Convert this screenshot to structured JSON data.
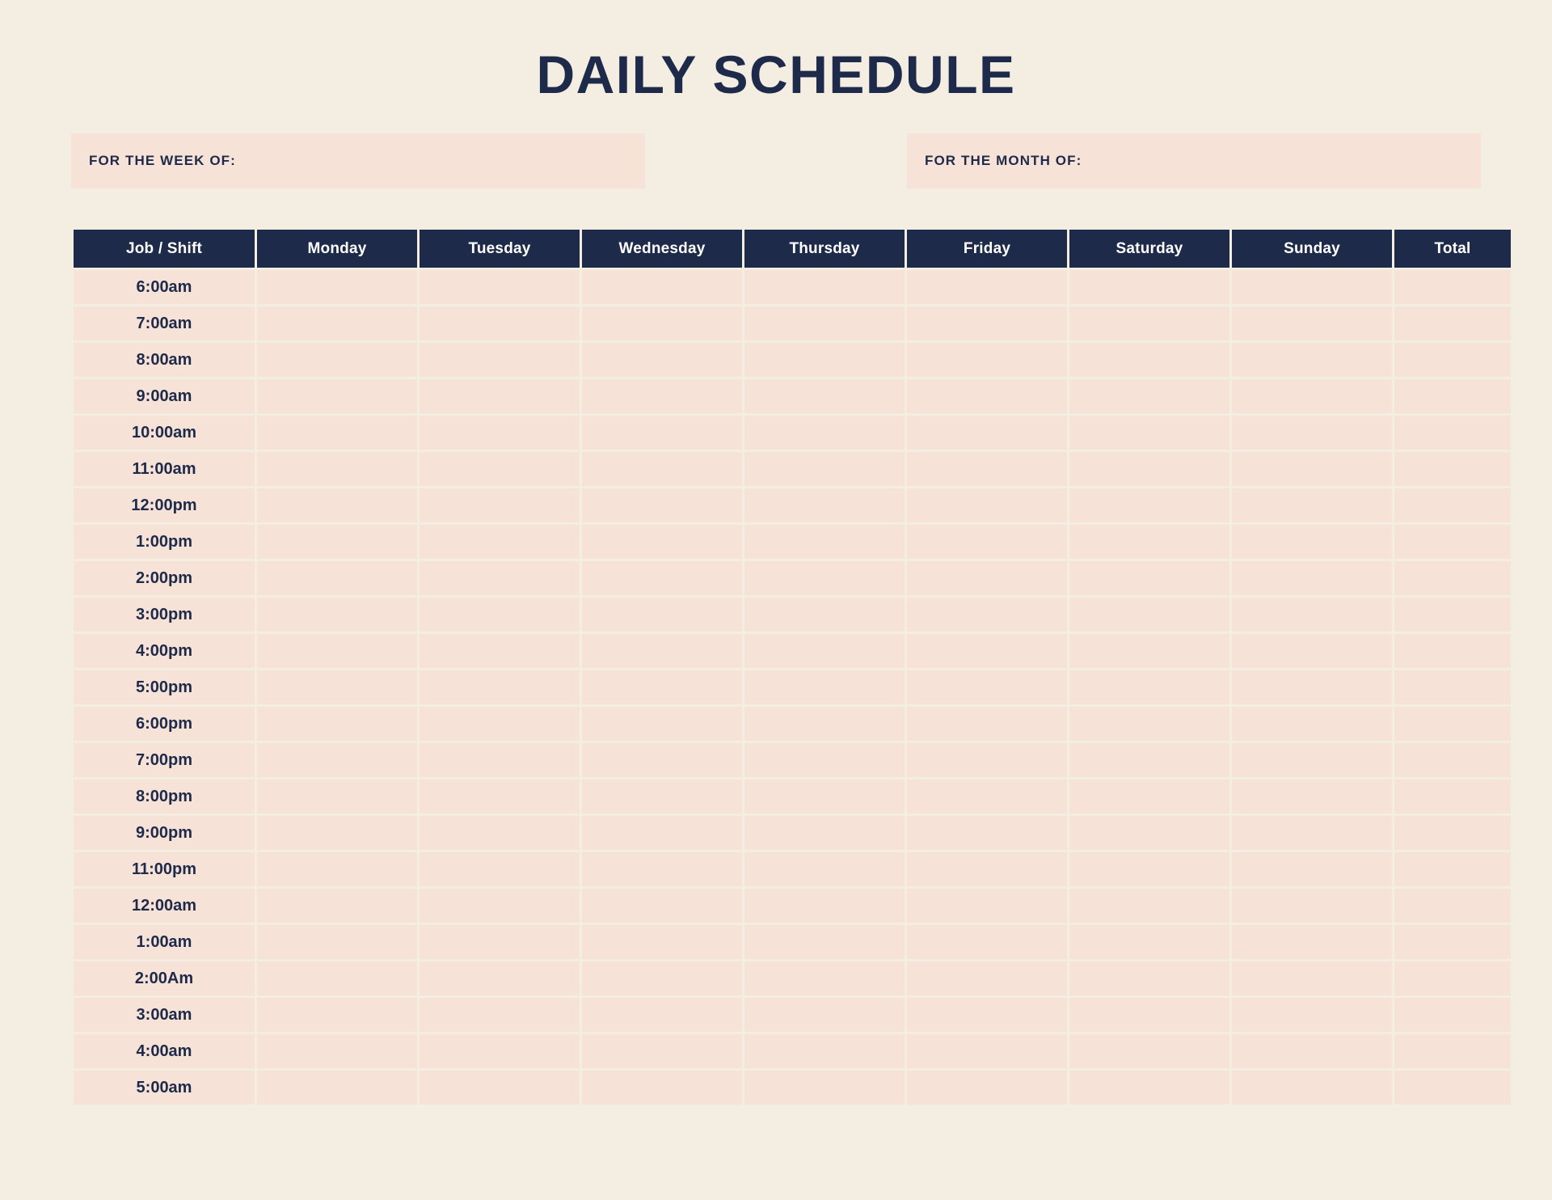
{
  "page": {
    "title": "DAILY SCHEDULE",
    "background_color": "#F4EDE1",
    "accent_navy": "#1E2A4A",
    "cell_peach": "#F7E2D7"
  },
  "meta": {
    "week_label": "FOR THE WEEK OF:",
    "week_value": "",
    "month_label": "FOR THE MONTH OF:",
    "month_value": ""
  },
  "table": {
    "columns": [
      "Job / Shift",
      "Monday",
      "Tuesday",
      "Wednesday",
      "Thursday",
      "Friday",
      "Saturday",
      "Sunday",
      "Total"
    ],
    "rows": [
      {
        "time": "6:00am",
        "entries": [
          "",
          "",
          "",
          "",
          "",
          "",
          "",
          ""
        ]
      },
      {
        "time": "7:00am",
        "entries": [
          "",
          "",
          "",
          "",
          "",
          "",
          "",
          ""
        ]
      },
      {
        "time": "8:00am",
        "entries": [
          "",
          "",
          "",
          "",
          "",
          "",
          "",
          ""
        ]
      },
      {
        "time": "9:00am",
        "entries": [
          "",
          "",
          "",
          "",
          "",
          "",
          "",
          ""
        ]
      },
      {
        "time": "10:00am",
        "entries": [
          "",
          "",
          "",
          "",
          "",
          "",
          "",
          ""
        ]
      },
      {
        "time": "11:00am",
        "entries": [
          "",
          "",
          "",
          "",
          "",
          "",
          "",
          ""
        ]
      },
      {
        "time": "12:00pm",
        "entries": [
          "",
          "",
          "",
          "",
          "",
          "",
          "",
          ""
        ]
      },
      {
        "time": "1:00pm",
        "entries": [
          "",
          "",
          "",
          "",
          "",
          "",
          "",
          ""
        ]
      },
      {
        "time": "2:00pm",
        "entries": [
          "",
          "",
          "",
          "",
          "",
          "",
          "",
          ""
        ]
      },
      {
        "time": "3:00pm",
        "entries": [
          "",
          "",
          "",
          "",
          "",
          "",
          "",
          ""
        ]
      },
      {
        "time": "4:00pm",
        "entries": [
          "",
          "",
          "",
          "",
          "",
          "",
          "",
          ""
        ]
      },
      {
        "time": "5:00pm",
        "entries": [
          "",
          "",
          "",
          "",
          "",
          "",
          "",
          ""
        ]
      },
      {
        "time": "6:00pm",
        "entries": [
          "",
          "",
          "",
          "",
          "",
          "",
          "",
          ""
        ]
      },
      {
        "time": "7:00pm",
        "entries": [
          "",
          "",
          "",
          "",
          "",
          "",
          "",
          ""
        ]
      },
      {
        "time": "8:00pm",
        "entries": [
          "",
          "",
          "",
          "",
          "",
          "",
          "",
          ""
        ]
      },
      {
        "time": "9:00pm",
        "entries": [
          "",
          "",
          "",
          "",
          "",
          "",
          "",
          ""
        ]
      },
      {
        "time": "11:00pm",
        "entries": [
          "",
          "",
          "",
          "",
          "",
          "",
          "",
          ""
        ]
      },
      {
        "time": "12:00am",
        "entries": [
          "",
          "",
          "",
          "",
          "",
          "",
          "",
          ""
        ]
      },
      {
        "time": "1:00am",
        "entries": [
          "",
          "",
          "",
          "",
          "",
          "",
          "",
          ""
        ]
      },
      {
        "time": "2:00Am",
        "entries": [
          "",
          "",
          "",
          "",
          "",
          "",
          "",
          ""
        ]
      },
      {
        "time": "3:00am",
        "entries": [
          "",
          "",
          "",
          "",
          "",
          "",
          "",
          ""
        ]
      },
      {
        "time": "4:00am",
        "entries": [
          "",
          "",
          "",
          "",
          "",
          "",
          "",
          ""
        ]
      },
      {
        "time": "5:00am",
        "entries": [
          "",
          "",
          "",
          "",
          "",
          "",
          "",
          ""
        ]
      }
    ]
  }
}
